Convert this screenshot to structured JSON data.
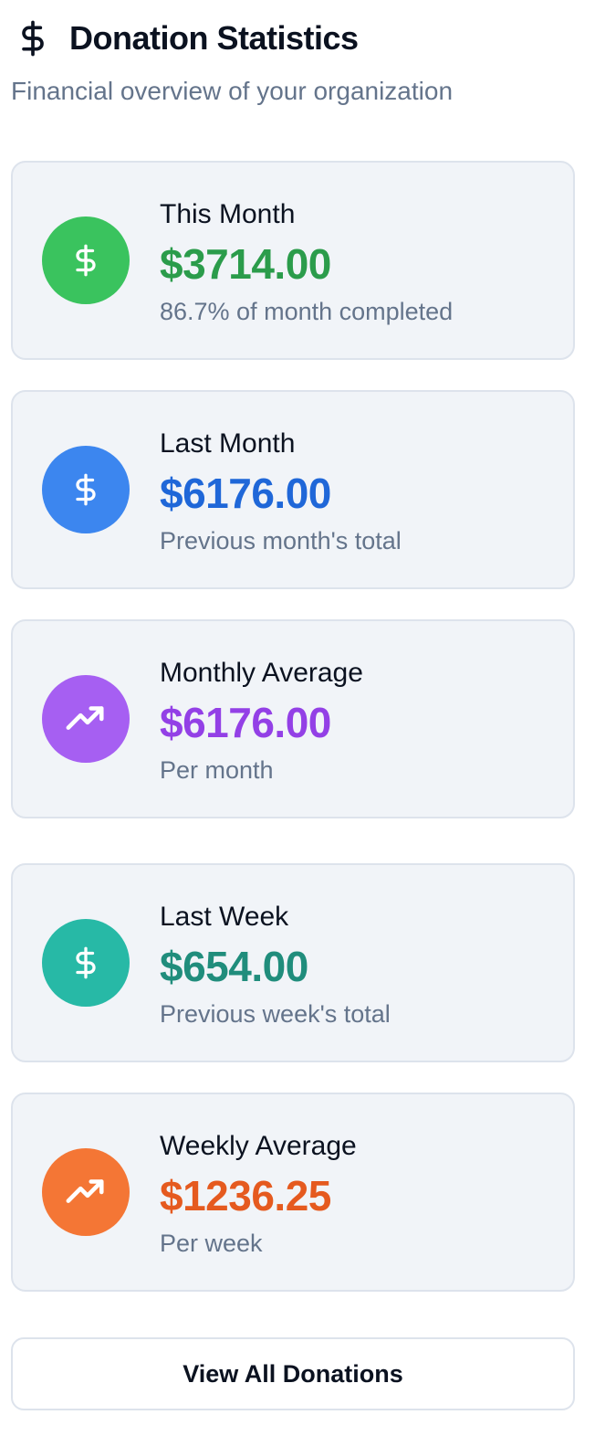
{
  "header": {
    "title": "Donation Statistics",
    "subtitle": "Financial overview of your organization",
    "icon": "dollar-icon"
  },
  "cards": [
    {
      "label": "This Month",
      "value": "$3714.00",
      "sub": "86.7% of month completed",
      "icon": "dollar-icon",
      "icon_color": "#3ac35e",
      "value_color": "#2b9c4b"
    },
    {
      "label": "Last Month",
      "value": "$6176.00",
      "sub": "Previous month's total",
      "icon": "dollar-icon",
      "icon_color": "#3c86ef",
      "value_color": "#1f67d8"
    },
    {
      "label": "Monthly Average",
      "value": "$6176.00",
      "sub": "Per month",
      "icon": "trending-up-icon",
      "icon_color": "#a65ff2",
      "value_color": "#9340e6"
    },
    {
      "label": "Last Week",
      "value": "$654.00",
      "sub": "Previous week's total",
      "icon": "dollar-icon",
      "icon_color": "#27b9a6",
      "value_color": "#208d7c"
    },
    {
      "label": "Weekly Average",
      "value": "$1236.25",
      "sub": "Per week",
      "icon": "trending-up-icon",
      "icon_color": "#f47635",
      "value_color": "#e55a1f"
    }
  ],
  "button": {
    "label": "View All Donations"
  }
}
